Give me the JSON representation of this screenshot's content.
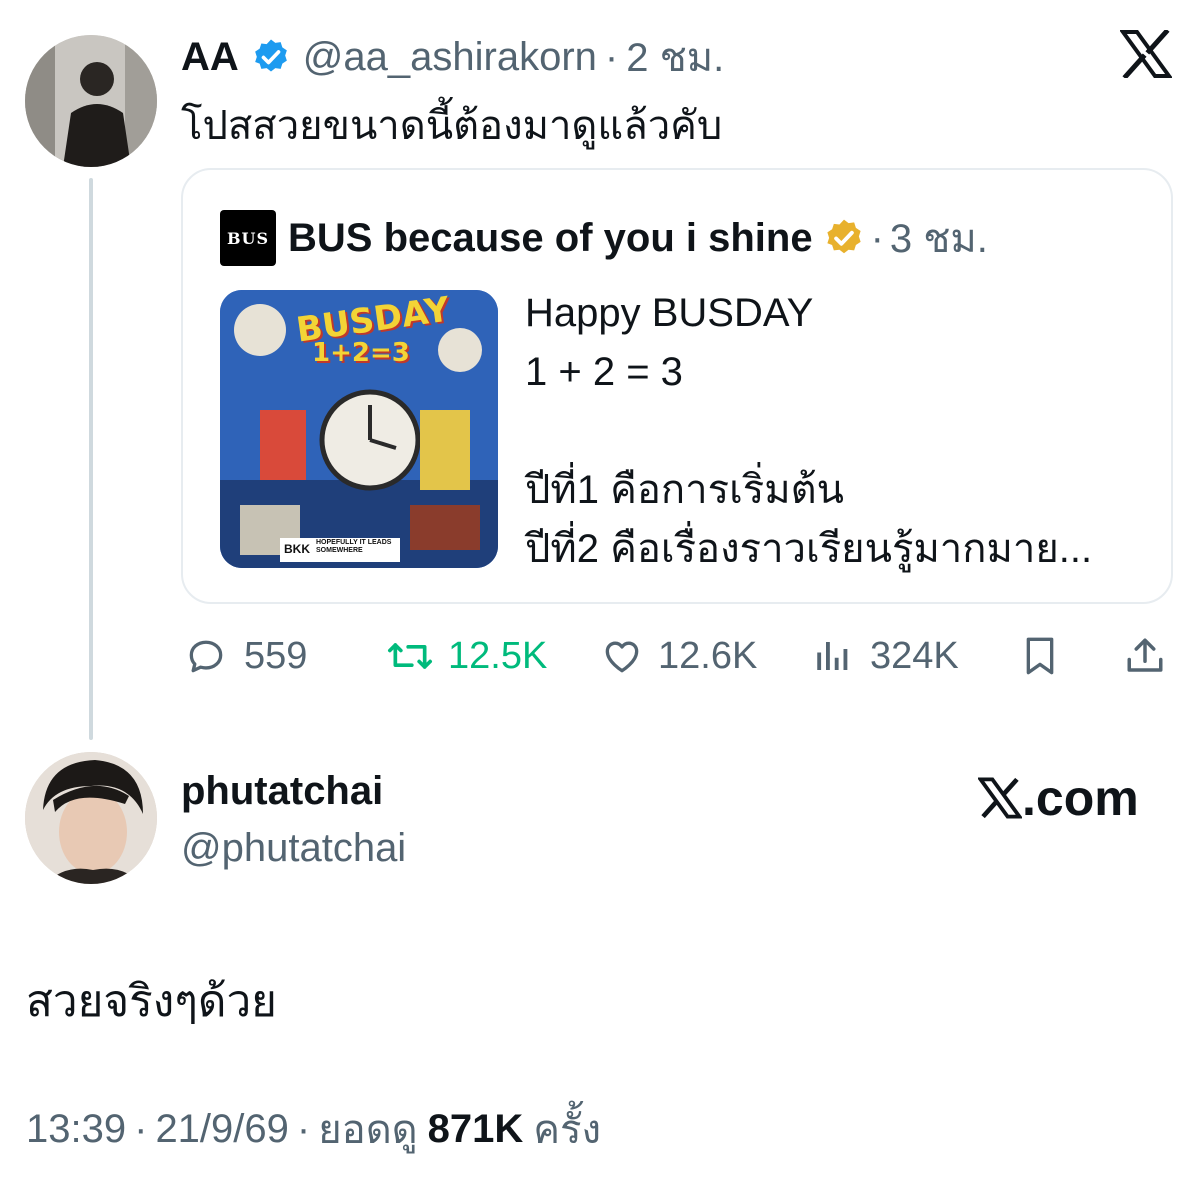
{
  "parent_tweet": {
    "author_name": "AA",
    "author_handle": "@aa_ashirakorn",
    "time": "2 ชม.",
    "text": "โปสสวยขนาดนี้ต้องมาดูแล้วคับ",
    "verified_color": "#1d9bf0"
  },
  "quoted_tweet": {
    "author_name": "BUS because of you i shine",
    "time": "3 ชม.",
    "verified_color": "#e8b12d",
    "image_title": "BUSDAY",
    "image_equation": "1+2=3",
    "image_banner": "HOPEFULLY IT LEADS SOMEWHERE",
    "image_tag": "BKK",
    "text_lines": [
      "Happy BUSDAY",
      "1 + 2 = 3",
      "",
      "ปีที่1 คือการเริ่มต้น",
      "ปีที่2 คือเรื่องราวเรียนรู้มากมาย..."
    ]
  },
  "actions": {
    "replies": "559",
    "reposts": "12.5K",
    "likes": "12.6K",
    "views": "324K",
    "repost_color": "#00ba7c"
  },
  "reply_tweet": {
    "author_name": "phutatchai",
    "author_handle": "@phutatchai",
    "text": "สวยจริงๆด้วย"
  },
  "footer": {
    "time": "13:39",
    "date": "21/9/69",
    "views_label": "ยอดดู",
    "views_count": "871K",
    "views_suffix": "ครั้ง"
  },
  "branding": {
    "x_logo": "X",
    "x_com": ".com"
  }
}
